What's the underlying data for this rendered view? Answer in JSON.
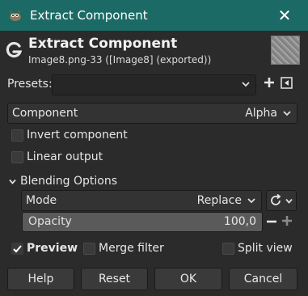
{
  "window": {
    "title": "Extract Component"
  },
  "header": {
    "title": "Extract Component",
    "subtitle": "Image8.png-33 ([Image8] (exported))"
  },
  "presets": {
    "label": "Presets:",
    "value": ""
  },
  "component": {
    "label": "Component",
    "value": "Alpha"
  },
  "options": {
    "invert_component": {
      "label": "Invert component",
      "checked": false
    },
    "linear_output": {
      "label": "Linear output",
      "checked": false
    }
  },
  "blending": {
    "label": "Blending Options",
    "mode_label": "Mode",
    "mode_value": "Replace",
    "opacity_label": "Opacity",
    "opacity_value": "100,0"
  },
  "preview": {
    "label": "Preview",
    "checked": true
  },
  "merge_filter": {
    "label": "Merge filter",
    "checked": false
  },
  "split_view": {
    "label": "Split view",
    "checked": false
  },
  "buttons": {
    "help": "Help",
    "reset": "Reset",
    "ok": "OK",
    "cancel": "Cancel"
  },
  "colors": {
    "titlebar": "#1c6a66",
    "background": "#2b2b2b",
    "opacity_bar": "#5a5a5a"
  },
  "icons": [
    "gimp-icon",
    "close-icon",
    "gegl-logo-icon",
    "chevron-down-icon",
    "add-preset-icon",
    "preset-menu-icon",
    "reset-mode-icon",
    "minus-icon",
    "plus-icon",
    "checkmark-icon"
  ]
}
